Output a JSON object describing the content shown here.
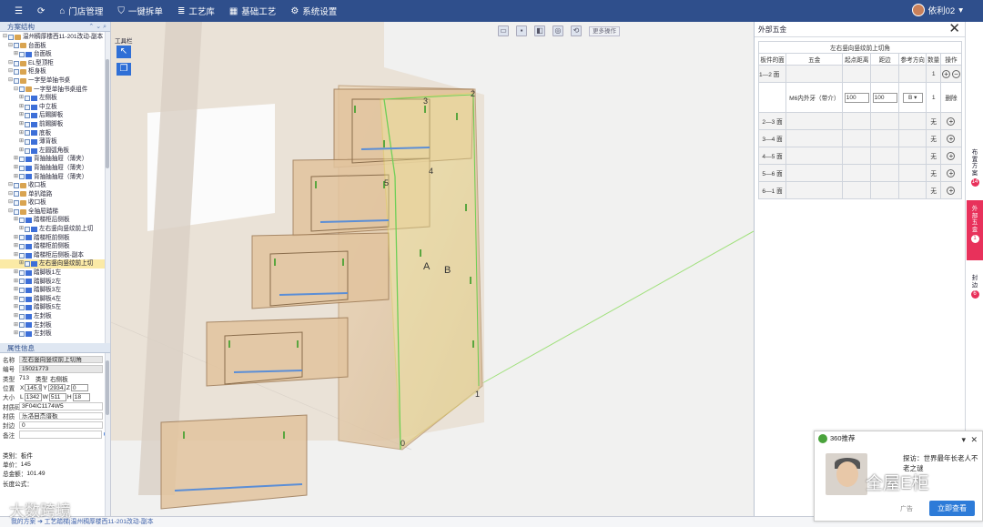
{
  "topbar": {
    "items": [
      {
        "icon": "menu-icon",
        "label": ""
      },
      {
        "icon": "refresh-icon",
        "label": ""
      },
      {
        "icon": "home-icon",
        "label": "门店管理"
      },
      {
        "icon": "shield-icon",
        "label": "一键拆单"
      },
      {
        "icon": "list-icon",
        "label": "工艺库"
      },
      {
        "icon": "grid-icon",
        "label": "基础工艺"
      },
      {
        "icon": "gear-icon",
        "label": "系统设置"
      }
    ],
    "user": "依利02",
    "colors": {
      "bar": "#2f4f8c",
      "accent": "#e8315b",
      "link": "#2f6fd6"
    }
  },
  "tree_panel": {
    "title": "方案结构",
    "nodes": [
      {
        "label": "温州稠厚楼西11-201改动-副本",
        "level": 0,
        "icon": "folder"
      },
      {
        "label": "台面板",
        "level": 1,
        "icon": "folder"
      },
      {
        "label": "台面板",
        "level": 2,
        "icon": "part"
      },
      {
        "label": "EL型顶柜",
        "level": 1,
        "icon": "folder"
      },
      {
        "label": "柜身板",
        "level": 1,
        "icon": "folder"
      },
      {
        "label": "一字型单抽书桌",
        "level": 1,
        "icon": "folder"
      },
      {
        "label": "一字型单抽书桌组件",
        "level": 2,
        "icon": "folder"
      },
      {
        "label": "左侧板",
        "level": 3,
        "icon": "part"
      },
      {
        "label": "中立板",
        "level": 3,
        "icon": "part"
      },
      {
        "label": "后踢脚板",
        "level": 3,
        "icon": "part"
      },
      {
        "label": "前踢脚板",
        "level": 3,
        "icon": "part"
      },
      {
        "label": "底板",
        "level": 3,
        "icon": "part"
      },
      {
        "label": "薄背板",
        "level": 3,
        "icon": "part"
      },
      {
        "label": "左圆弧角板",
        "level": 3,
        "icon": "part"
      },
      {
        "label": "背抽抽抽屉（薄夹）",
        "level": 2,
        "icon": "part"
      },
      {
        "label": "背抽抽抽屉（薄夹）",
        "level": 2,
        "icon": "part"
      },
      {
        "label": "背抽抽抽屉（薄夹）",
        "level": 2,
        "icon": "part"
      },
      {
        "label": "收口板",
        "level": 1,
        "icon": "folder"
      },
      {
        "label": "单扒踏路",
        "level": 1,
        "icon": "folder"
      },
      {
        "label": "收口板",
        "level": 1,
        "icon": "folder"
      },
      {
        "label": "全抽屉踏梯",
        "level": 1,
        "icon": "folder"
      },
      {
        "label": "踏梯柜后侧板",
        "level": 2,
        "icon": "part"
      },
      {
        "label": "左右竖向竖纹前上切",
        "level": 3,
        "icon": "part"
      },
      {
        "label": "踏梯柜前侧板",
        "level": 2,
        "icon": "part"
      },
      {
        "label": "踏梯柜前侧板",
        "level": 2,
        "icon": "part"
      },
      {
        "label": "踏梯柜后侧板-副本",
        "level": 2,
        "icon": "part"
      },
      {
        "label": "左右竖向竖纹前上切",
        "level": 3,
        "icon": "part",
        "selected": true
      },
      {
        "label": "踏脚板1左",
        "level": 2,
        "icon": "part"
      },
      {
        "label": "踏脚板2左",
        "level": 2,
        "icon": "part"
      },
      {
        "label": "踏脚板3左",
        "level": 2,
        "icon": "part"
      },
      {
        "label": "踏脚板4左",
        "level": 2,
        "icon": "part"
      },
      {
        "label": "踏脚板5左",
        "level": 2,
        "icon": "part"
      },
      {
        "label": "左封板",
        "level": 2,
        "icon": "part"
      },
      {
        "label": "左封板",
        "level": 2,
        "icon": "part"
      },
      {
        "label": "左封板",
        "level": 2,
        "icon": "part"
      }
    ]
  },
  "props_panel": {
    "title": "属性信息",
    "name_label": "名称",
    "name_value": "左右竖向竖纹前上切角",
    "code_label": "编号",
    "code_value": "15021773",
    "type_label": "类型",
    "type_value": "713",
    "kind_label": "类型",
    "kind_value": "右侧板",
    "pos_label": "位置",
    "pos_x": "145.92",
    "pos_y": "2934.9",
    "pos_z": "0",
    "size_label": "大小",
    "size_l": "1342",
    "size_w": "511",
    "size_h": "18",
    "mat_code_label": "材质码",
    "mat_code": "3F04IC1174W5",
    "mat_label": "材质",
    "mat_value": "乐洛自杰谱板",
    "edge_label": "封边",
    "edge_value": "0",
    "note_label": "备注",
    "note_value": "",
    "cat_label": "类别：",
    "cat_value": "板件",
    "price_label": "单价：",
    "price_value": "145",
    "total_label": "总金额：",
    "total_value": "101.49",
    "formula_label": "长度公式："
  },
  "status": {
    "path": "我的方案 ➔ 工艺踏梯|温州稠厚楼西11-201改动-副本"
  },
  "scene": {
    "tools_label": "工具栏",
    "more_label": "更多操作",
    "markers": [
      "1",
      "2",
      "3",
      "4",
      "5",
      "0",
      "A",
      "B"
    ]
  },
  "hardware_panel": {
    "title": "外部五金",
    "caption": "左右竖向竖纹前上切角",
    "columns": [
      "板件的面",
      "五金",
      "起点距离",
      "距边",
      "参考方向",
      "数量",
      "操作"
    ],
    "rows": [
      {
        "face": "1—2 面",
        "qty": "1"
      },
      {
        "face": "",
        "hw": "M6内外牙（带介）",
        "start": "100",
        "edge": "100",
        "dir": "B",
        "qty": "1",
        "op": "删除"
      },
      {
        "face": "2—3 面",
        "qty": "无"
      },
      {
        "face": "3—4 面",
        "qty": "无"
      },
      {
        "face": "4—5 面",
        "qty": "无"
      },
      {
        "face": "5—6 面",
        "qty": "无"
      },
      {
        "face": "6—1 面",
        "qty": "无"
      }
    ]
  },
  "side_tabs": [
    {
      "label": "布置方案",
      "badge": "14",
      "active": false
    },
    {
      "label": "外部五金",
      "badge": "1",
      "active": true
    },
    {
      "label": "封边",
      "badge": "6",
      "active": false
    }
  ],
  "ad": {
    "source": "360推荐",
    "headline": "探访：世界最年长老人不老之谜",
    "watermark": "全屋E柜",
    "tag": "广告",
    "button": "立即查看"
  },
  "watermark": "大数跨境"
}
